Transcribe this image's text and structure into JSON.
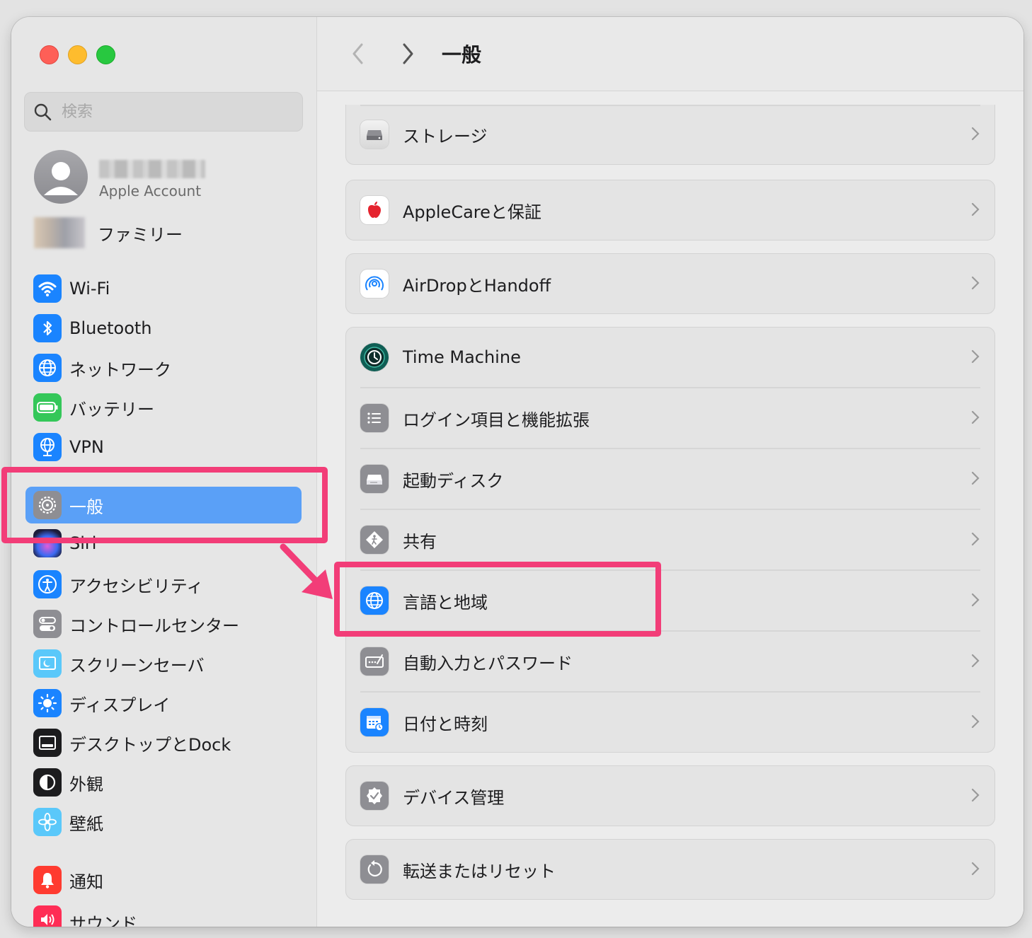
{
  "window": {
    "title": "一般"
  },
  "sidebar": {
    "search_placeholder": "検索",
    "account_subtitle": "Apple Account",
    "family_label": "ファミリー",
    "items": [
      {
        "label": "Wi-Fi",
        "icon": "wifi-icon",
        "color": "#1a84ff"
      },
      {
        "label": "Bluetooth",
        "icon": "bluetooth-icon",
        "color": "#1a84ff"
      },
      {
        "label": "ネットワーク",
        "icon": "globe-icon",
        "color": "#1a84ff"
      },
      {
        "label": "バッテリー",
        "icon": "battery-icon",
        "color": "#34c759"
      },
      {
        "label": "VPN",
        "icon": "vpn-globe-icon",
        "color": "#1a84ff"
      },
      {
        "label": "一般",
        "icon": "gear-icon",
        "color": "#8e8e93",
        "selected": true
      },
      {
        "label": "Siri",
        "icon": "siri-icon",
        "color": "#2b2b5e"
      },
      {
        "label": "アクセシビリティ",
        "icon": "accessibility-icon",
        "color": "#1a84ff"
      },
      {
        "label": "コントロールセンター",
        "icon": "control-center-icon",
        "color": "#8e8e93"
      },
      {
        "label": "スクリーンセーバ",
        "icon": "screensaver-icon",
        "color": "#5ac8fa"
      },
      {
        "label": "ディスプレイ",
        "icon": "display-sun-icon",
        "color": "#1a84ff"
      },
      {
        "label": "デスクトップとDock",
        "icon": "dock-icon",
        "color": "#1c1c1e"
      },
      {
        "label": "外観",
        "icon": "appearance-icon",
        "color": "#1c1c1e"
      },
      {
        "label": "壁紙",
        "icon": "wallpaper-flower-icon",
        "color": "#5ac8fa"
      },
      {
        "label": "通知",
        "icon": "bell-icon",
        "color": "#ff3b30"
      },
      {
        "label": "サウンド",
        "icon": "speaker-icon",
        "color": "#ff2d55"
      }
    ]
  },
  "main": {
    "groups": [
      {
        "rows": [
          {
            "label": "ストレージ",
            "icon": "storage-drive-icon"
          }
        ]
      },
      {
        "rows": [
          {
            "label": "AppleCareと保証",
            "icon": "apple-logo-icon"
          }
        ]
      },
      {
        "rows": [
          {
            "label": "AirDropとHandoff",
            "icon": "airdrop-icon"
          }
        ]
      },
      {
        "rows": [
          {
            "label": "Time Machine",
            "icon": "time-machine-icon"
          },
          {
            "label": "ログイン項目と機能拡張",
            "icon": "list-icon"
          },
          {
            "label": "起動ディスク",
            "icon": "startup-disk-icon"
          },
          {
            "label": "共有",
            "icon": "sharing-icon"
          },
          {
            "label": "言語と地域",
            "icon": "language-globe-icon"
          },
          {
            "label": "自動入力とパスワード",
            "icon": "autofill-icon"
          },
          {
            "label": "日付と時刻",
            "icon": "calendar-clock-icon"
          }
        ]
      },
      {
        "rows": [
          {
            "label": "デバイス管理",
            "icon": "device-management-badge-icon"
          }
        ]
      },
      {
        "rows": [
          {
            "label": "転送またはリセット",
            "icon": "reset-icon"
          }
        ]
      }
    ]
  },
  "annotations": {
    "highlight_color": "#f23d78"
  }
}
